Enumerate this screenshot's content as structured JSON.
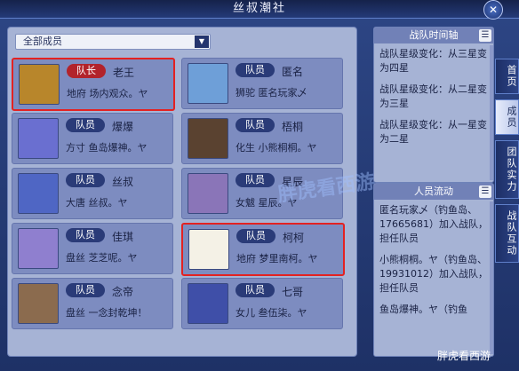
{
  "window": {
    "title": "丝叔潮社",
    "close": "✕"
  },
  "filter": {
    "label": "全部成员"
  },
  "members": [
    {
      "role": "队长",
      "name": "老王",
      "info": "地府 场内观众。ヤ",
      "highlight": true
    },
    {
      "role": "队员",
      "name": "匿名",
      "info": "狮驼 匿名玩家乄",
      "highlight": false
    },
    {
      "role": "队员",
      "name": "爆爆",
      "info": "方寸 鱼岛爆神。ヤ",
      "highlight": false
    },
    {
      "role": "队员",
      "name": "梧桐",
      "info": "化生 小熊桐桐。ヤ",
      "highlight": false
    },
    {
      "role": "队员",
      "name": "丝叔",
      "info": "大唐 丝叔。ヤ",
      "highlight": false
    },
    {
      "role": "队员",
      "name": "星辰",
      "info": "女魃 星辰。ヤ",
      "highlight": false
    },
    {
      "role": "队员",
      "name": "佳琪",
      "info": "盘丝 芝芝呢。ヤ",
      "highlight": false
    },
    {
      "role": "队员",
      "name": "柯柯",
      "info": "地府 梦里南柯。ヤ",
      "highlight": true
    },
    {
      "role": "队员",
      "name": "念帝",
      "info": "盘丝 一念封乾坤！",
      "highlight": false
    },
    {
      "role": "队员",
      "name": "七哥",
      "info": "女儿 叁伍柒。ヤ",
      "highlight": false
    }
  ],
  "timeline": {
    "title": "战队时间轴",
    "entries": [
      "战队星级变化：从三星变为四星",
      "战队星级变化：从二星变为三星",
      "战队星级变化：从一星变为二星"
    ]
  },
  "flow": {
    "title": "人员流动",
    "entries": [
      "匿名玩家乄（钓鱼岛、17665681）加入战队，担任队员",
      "小熊桐桐。ヤ（钓鱼岛、19931012）加入战队，担任队员",
      "鱼岛爆神。ヤ（钓鱼"
    ]
  },
  "tabs": [
    "首页",
    "成员",
    "团队实力",
    "战队互动"
  ],
  "watermark": "胖虎看西游",
  "source": "胖虎看西游"
}
